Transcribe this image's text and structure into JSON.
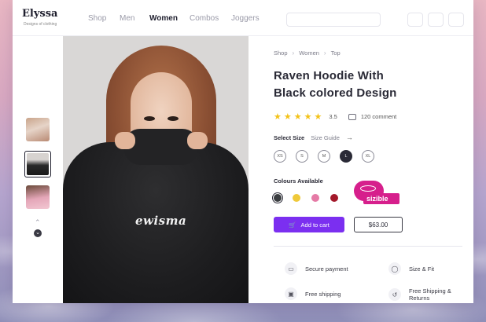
{
  "header": {
    "logo": "Elyssa",
    "logo_tagline": "Designs of clothing",
    "nav": [
      "Shop",
      "Men",
      "Women",
      "Combos",
      "Joggers"
    ],
    "active_nav": "Women"
  },
  "breadcrumb": [
    "Shop",
    "Women",
    "Top"
  ],
  "product": {
    "title_line1": "Raven Hoodie With",
    "title_line2": "Black colored Design",
    "rating_value": "3.5",
    "stars_filled": 5,
    "comments": "120 comment",
    "print_text": "ewisma"
  },
  "size": {
    "label": "Select Size",
    "guide": "Size Guide",
    "options": [
      "XS",
      "S",
      "M",
      "L",
      "XL"
    ],
    "selected": "L"
  },
  "colours": {
    "label": "Colours Available",
    "options": [
      "#3a3d40",
      "#efc93a",
      "#e57aa6",
      "#a3182a"
    ],
    "selected_index": 0
  },
  "sizible_badge": "sizible",
  "actions": {
    "add_to_cart": "Add to cart",
    "price": "$63.00"
  },
  "features": [
    {
      "icon": "card-icon",
      "label": "Secure payment"
    },
    {
      "icon": "shirt-icon",
      "label": "Size & Fit"
    },
    {
      "icon": "truck-icon",
      "label": "Free shipping"
    },
    {
      "icon": "return-icon",
      "label": "Free Shipping & Returns"
    }
  ],
  "colors": {
    "accent": "#7b2ff0",
    "star": "#f3c218",
    "sizible": "#d61f8c"
  }
}
